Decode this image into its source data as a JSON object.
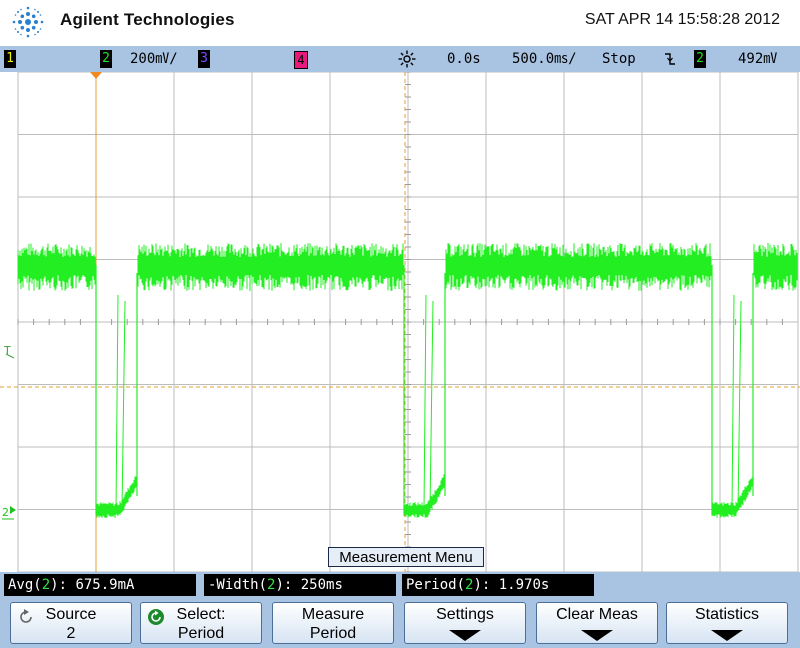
{
  "header": {
    "brand": "Agilent Technologies",
    "datetime": "SAT APR 14 15:58:28 2012",
    "logo_icon": "agilent-spark-icon"
  },
  "status": {
    "ch1": "1",
    "ch2": "2",
    "ch2_scale": "200㎷/",
    "ch3": "3",
    "ch4": "4",
    "acq_icon": "sun-icon",
    "delay": "0.0s",
    "timebase": "500.0㎳/",
    "run_state": "Stop",
    "trigger_icon": "trigger-falling-edge-icon",
    "trig_source": "2",
    "trig_level": "492㎷",
    "colors": {
      "ch1": "#f0f000",
      "ch2": "#20e020",
      "ch3": "#7a4cff",
      "ch4": "#e8187e"
    }
  },
  "screen": {
    "trigger_level_marker": "T",
    "ch2_ground_marker": "2",
    "trace_color": "#22ee22",
    "grid_divisions": {
      "x": 10,
      "y": 8
    }
  },
  "meas_menu_label": "Measurement Menu",
  "measurements": [
    {
      "prefix": "Avg(",
      "channel": "2",
      "suffix": "): 675.9mA"
    },
    {
      "prefix": "-Width(",
      "channel": "2",
      "suffix": "): 250ms"
    },
    {
      "prefix": "Period(",
      "channel": "2",
      "suffix": "): 1.970s"
    }
  ],
  "softkeys": [
    {
      "line1": "Source",
      "line2": "2",
      "icon": "rotate-knob-icon"
    },
    {
      "line1": "Select:",
      "line2": "Period",
      "icon": "entry-knob-icon"
    },
    {
      "line1": "Measure",
      "line2": "Period"
    },
    {
      "line1": "Settings",
      "icon": "submenu-arrow-icon"
    },
    {
      "line1": "Clear Meas",
      "icon": "submenu-arrow-icon"
    },
    {
      "line1": "Statistics",
      "icon": "submenu-arrow-icon"
    }
  ]
}
